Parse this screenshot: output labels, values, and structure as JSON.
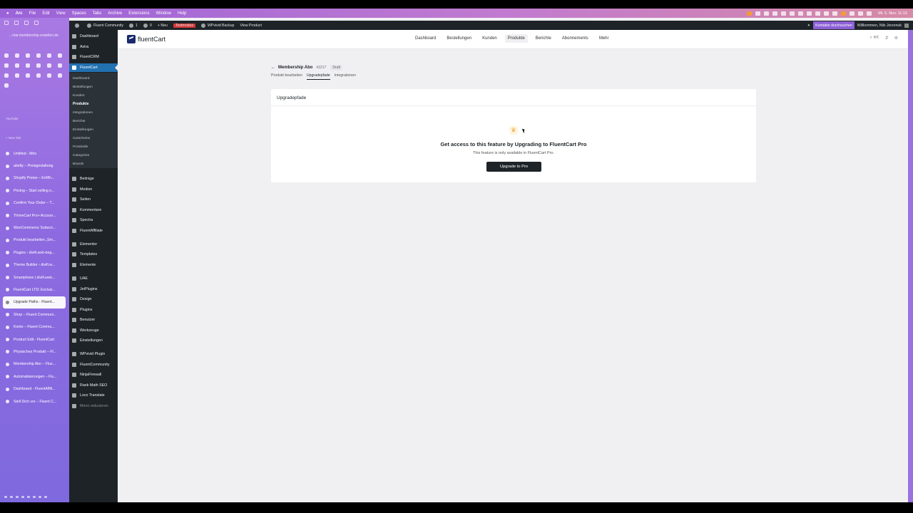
{
  "mac_menubar": {
    "app": "Arc",
    "menus": [
      "File",
      "Edit",
      "View",
      "Spaces",
      "Tabs",
      "Archive",
      "Extensions",
      "Window",
      "Help"
    ],
    "clock": "Mi. 5. Nov. 11:13"
  },
  "arc": {
    "url": "...ntar.membership-erstellen.de",
    "youtube": "YouTube",
    "new_tab": "+ New Tab",
    "tabs": [
      "Untitled - Miro",
      "abelty – Preisgestaltung",
      "Shopify Preise – Eröffn...",
      "Pricing – Start selling o...",
      "Confirm Your Order – T...",
      "ThriveCart Pro+ Accoun...",
      "WooCommerce Subscri...",
      "Produkt bearbeiten „Sm...",
      "Plugins ‹ divifi.web-beg...",
      "Theme Builder ‹ divifi.w...",
      "Smartphone | divifi.web...",
      "FluentCart LTD: Exclusi...",
      "Upgrade Paths - Fluent...",
      "Shop – Fluent Communi...",
      "Konto – Fluent Commu...",
      "Product Edit - FluentCart",
      "Physisches Produkt – Fl...",
      "Membership Abo – Flue...",
      "Automatisierungen – Flu...",
      "Dashboard - FluentAffili...",
      "Stell Dich vor – Fluent C..."
    ],
    "active_tab_index": 12
  },
  "adminbar": {
    "site": "Fluent Community",
    "updates": "1",
    "comments": "0",
    "new": "+ Neu",
    "testmode": "Testmodus",
    "backup": "WPvivid Backup",
    "view": "View Product",
    "contact": "Kontakte durchsuchen",
    "greeting": "Willkommen, Nils Jorzenuk"
  },
  "wp_menu": {
    "top": [
      "Dashboard",
      "Astra",
      "FluentCRM",
      "FluentCart"
    ],
    "fluentcart_sub": [
      "Dashboard",
      "Bestellungen",
      "Kunden",
      "Produkte",
      "Integrationen",
      "Berichte",
      "Einstellungen",
      "Gutscheine",
      "Protokolle",
      "Categories",
      "Brands"
    ],
    "current_sub": "Produkte",
    "rest": [
      "Beiträge",
      "Medien",
      "Seiten",
      "Kommentare",
      "Spectra",
      "FluentAffiliate",
      "Elementor",
      "Templates",
      "Elemente",
      "UAE",
      "JetPlugins",
      "Design",
      "Plugins",
      "Benutzer",
      "Werkzeuge",
      "Einstellungen",
      "WPvivid Plugin",
      "FluentCommunity",
      "NinjaFirewall",
      "Rank Math SEO",
      "Loco Translate"
    ],
    "collapse": "Menü reduzieren"
  },
  "app": {
    "logo": "fluentCart",
    "nav": [
      "Dashboard",
      "Bestellungen",
      "Kunden",
      "Produkte",
      "Berichte",
      "Abonnements",
      "Mehr"
    ],
    "active_nav": "Produkte",
    "search_shortcut": "⌘K"
  },
  "product": {
    "title": "Membership Abo",
    "id": "#2217",
    "status": "Draft",
    "tabs": [
      "Produkt bearbeiten",
      "Upgradepfade",
      "Integrationen"
    ],
    "active_tab": "Upgradepfade"
  },
  "card": {
    "header": "Upgradepfade",
    "heading": "Get access to this feature by Upgrading to FluentCart Pro",
    "text": "This feature is only available in FluentCart Pro.",
    "button": "Upgrade to Pro"
  }
}
